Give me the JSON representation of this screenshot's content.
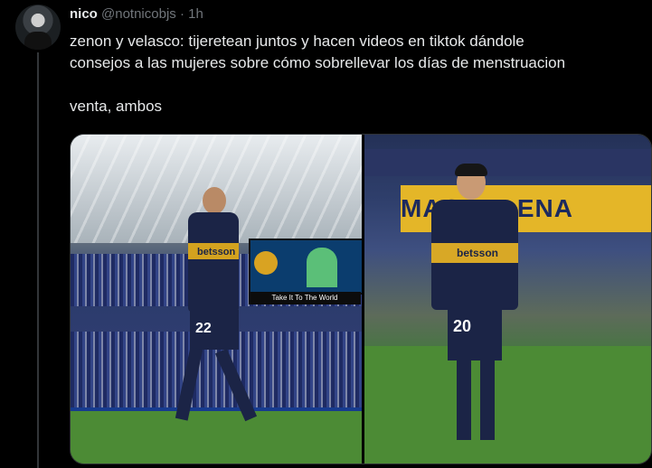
{
  "author": {
    "name": "nico",
    "handle": "@notnicobjs",
    "separator": "·",
    "time": "1h"
  },
  "tweet": {
    "line1": "zenon y velasco: tijeretean juntos y hacen videos en tiktok dándole",
    "line2": "consejos a las mujeres sobre cómo sobrellevar los días de menstruacion",
    "line3": "venta, ambos"
  },
  "media": {
    "left_photo": {
      "jersey_number": "22",
      "sponsor": "betsson",
      "screen_caption": "Take It To The World"
    },
    "right_photo": {
      "jersey_number": "20",
      "sponsor": "betsson",
      "banner_text": "MAGDALENA"
    }
  },
  "colors": {
    "background": "#000000",
    "text_primary": "#e7e9ea",
    "text_secondary": "#71767b",
    "boca_blue": "#1b2446",
    "boca_gold": "#d8a826"
  }
}
